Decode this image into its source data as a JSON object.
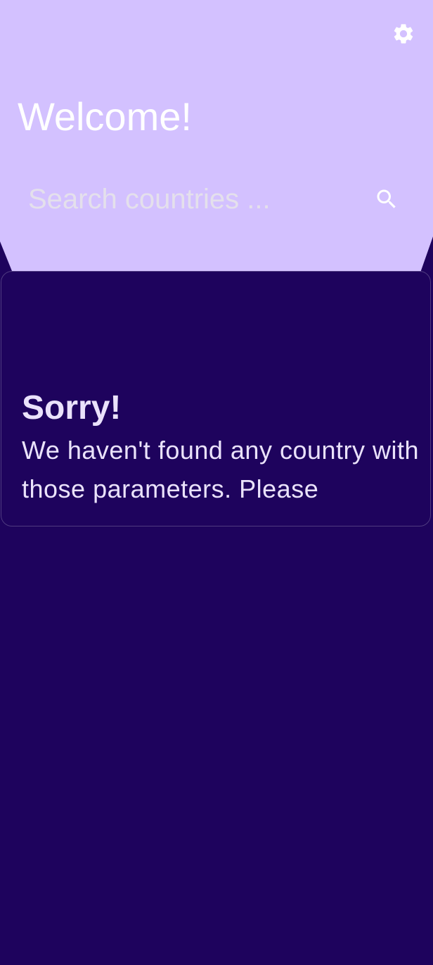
{
  "header": {
    "title": "Welcome!",
    "background_color": "#d3c1ff",
    "settings_icon": "gear-icon"
  },
  "search": {
    "placeholder": "Search countries ...",
    "value": "",
    "icon": "search-icon"
  },
  "empty_state": {
    "title": "Sorry!",
    "message": "We haven't found any country with those parameters. Please"
  },
  "colors": {
    "page_background": "#1e035d",
    "header_background": "#d3c1ff",
    "card_text": "#eae2fb"
  }
}
